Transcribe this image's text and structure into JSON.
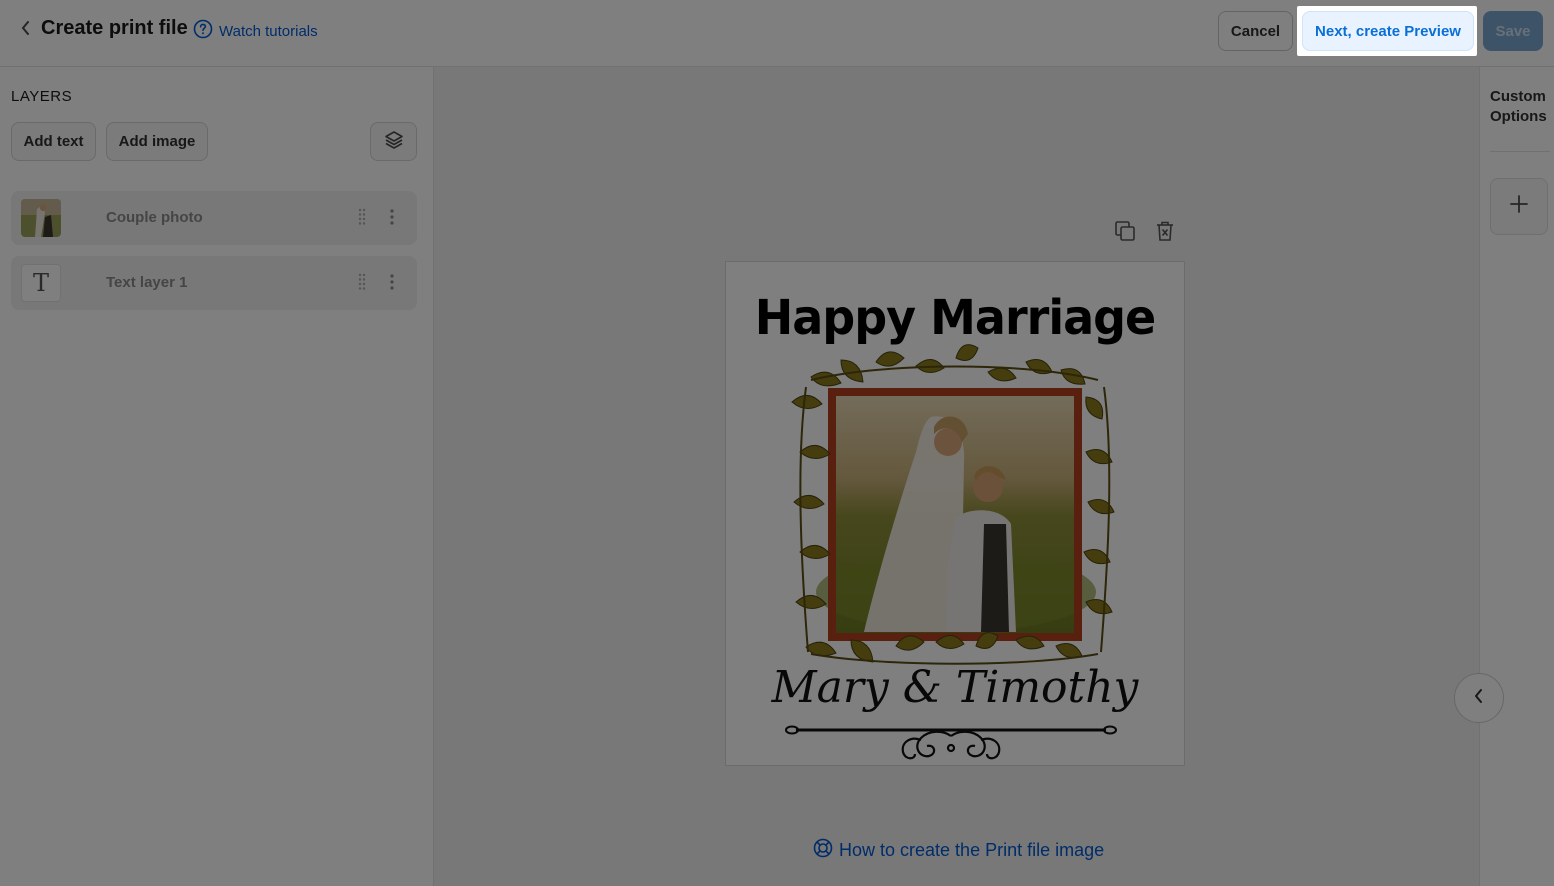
{
  "header": {
    "title": "Create print file",
    "tutorial_link": "Watch tutorials",
    "cancel_label": "Cancel",
    "next_label": "Next, create Preview",
    "save_label": "Save"
  },
  "layers_panel": {
    "title": "LAYERS",
    "add_text_label": "Add text",
    "add_image_label": "Add image",
    "items": [
      {
        "label": "Couple photo",
        "type": "image"
      },
      {
        "label": "Text layer 1",
        "type": "text",
        "glyph": "T"
      }
    ]
  },
  "canvas": {
    "design_title": "Happy Marriage",
    "design_names": "Mary & Timothy",
    "help_link": "How to create the Print file image"
  },
  "right_panel": {
    "title": "Custom Options"
  },
  "colors": {
    "link_blue": "#005bd3",
    "frame_red": "#b5401f",
    "leaf_gold": "#8a7a1c"
  }
}
